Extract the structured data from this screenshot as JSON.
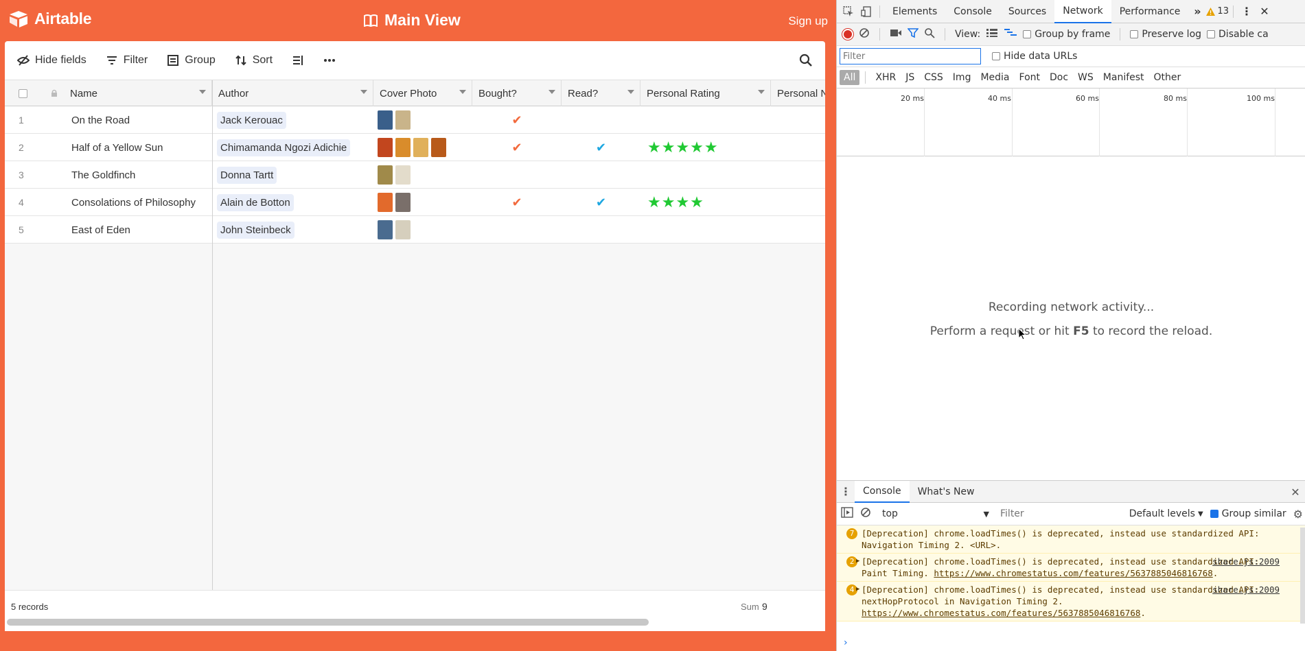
{
  "airtable": {
    "brand": "Airtable",
    "view_title": "Main View",
    "signup": "Sign up",
    "toolbar": {
      "hide_fields": "Hide fields",
      "filter": "Filter",
      "group": "Group",
      "sort": "Sort"
    },
    "columns": [
      "Name",
      "Author",
      "Cover Photo",
      "Bought?",
      "Read?",
      "Personal Rating",
      "Personal N"
    ],
    "rows": [
      {
        "num": "1",
        "name": "On the Road",
        "author": "Jack Kerouac",
        "thumbs": [
          "#3a5f8a",
          "#c9b48a"
        ],
        "bought": true,
        "read": false,
        "rating": 0
      },
      {
        "num": "2",
        "name": "Half of a Yellow Sun",
        "author": "Chimamanda Ngozi Adichie",
        "thumbs": [
          "#c2461e",
          "#d98c2b",
          "#e0b05a",
          "#b85a1a"
        ],
        "bought": true,
        "read": true,
        "rating": 5
      },
      {
        "num": "3",
        "name": "The Goldfinch",
        "author": "Donna Tartt",
        "thumbs": [
          "#a08a4a",
          "#e3dccb"
        ],
        "bought": false,
        "read": false,
        "rating": 0
      },
      {
        "num": "4",
        "name": "Consolations of Philosophy",
        "author": "Alain de Botton",
        "thumbs": [
          "#e26a2c",
          "#7a6f6a"
        ],
        "bought": true,
        "read": true,
        "rating": 4
      },
      {
        "num": "5",
        "name": "East of Eden",
        "author": "John Steinbeck",
        "thumbs": [
          "#4a6b8f",
          "#d6cfbd"
        ],
        "bought": false,
        "read": false,
        "rating": 0
      }
    ],
    "footer": {
      "records": "5 records",
      "sum_label": "Sum",
      "sum_value": "9"
    },
    "colors": {
      "brand": "#f3673e",
      "check_bought": "#f26a3d",
      "check_read": "#1ea7e1",
      "stars": "#20c933"
    }
  },
  "devtools": {
    "tabs": [
      "Elements",
      "Console",
      "Sources",
      "Network",
      "Performance"
    ],
    "active_tab": "Network",
    "warning_count": "13",
    "toolbar": {
      "view_label": "View:",
      "group_by_frame": "Group by frame",
      "preserve_log": "Preserve log",
      "disable_cache": "Disable ca"
    },
    "filter_placeholder": "Filter",
    "hide_data_urls": "Hide data URLs",
    "types": [
      "All",
      "XHR",
      "JS",
      "CSS",
      "Img",
      "Media",
      "Font",
      "Doc",
      "WS",
      "Manifest",
      "Other"
    ],
    "ticks": [
      "20 ms",
      "40 ms",
      "60 ms",
      "80 ms",
      "100 ms"
    ],
    "empty_line1": "Recording network activity...",
    "empty_line2_a": "Perform a request or hit ",
    "empty_line2_key": "F5",
    "empty_line2_b": " to record the reload.",
    "drawer": {
      "tabs": [
        "Console",
        "What's New"
      ],
      "context": "top",
      "filter_placeholder": "Filter",
      "levels": "Default levels",
      "group_similar": "Group similar",
      "messages": [
        {
          "count": "7",
          "text": "[Deprecation] chrome.loadTimes() is deprecated, instead use standardized API: Navigation Timing 2. <URL>.",
          "src": ""
        },
        {
          "count": "2",
          "text": "[Deprecation] chrome.loadTimes() is deprecated, instead use standardized API: Paint Timing. ",
          "link": "https://www.chromestatus.com/features/5637885046816768",
          "tail": ".",
          "src": "share.js:2009"
        },
        {
          "count": "4",
          "text": "[Deprecation] chrome.loadTimes() is deprecated, instead use standardized API: nextHopProtocol in Navigation Timing 2. ",
          "link": "https://www.chromestatus.com/features/5637885046816768",
          "tail": ".",
          "src": "share.js:2009"
        }
      ]
    }
  }
}
